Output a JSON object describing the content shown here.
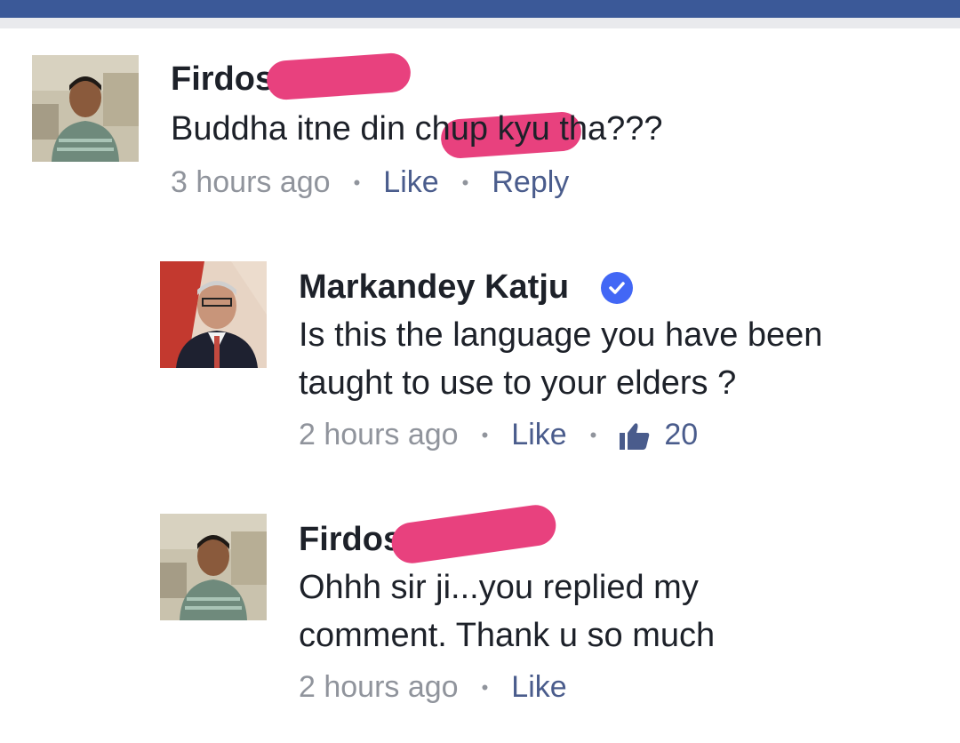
{
  "comments": [
    {
      "author": "Firdos",
      "text_lines": [
        "Buddha itne din chup kyu tha???"
      ],
      "time": "3 hours ago",
      "like_label": "Like",
      "reply_label": "Reply"
    },
    {
      "author": "Markandey Katju",
      "verified": true,
      "text_lines": [
        "Is this the language you have been",
        "taught to use to your elders ?"
      ],
      "time": "2 hours ago",
      "like_label": "Like",
      "like_count": "20"
    },
    {
      "author": "Firdos",
      "text_lines": [
        "Ohhh sir ji...you replied my",
        "comment. Thank u so much"
      ],
      "time": "2 hours ago",
      "like_label": "Like"
    }
  ],
  "colors": {
    "header": "#3b5998",
    "redaction": "#e8417e",
    "verified_badge": "#4267f5",
    "action_text": "#4a5c8c",
    "meta_text": "#90949c"
  },
  "icons": {
    "verified": "check-badge-icon",
    "like_count": "thumbs-up-icon"
  }
}
